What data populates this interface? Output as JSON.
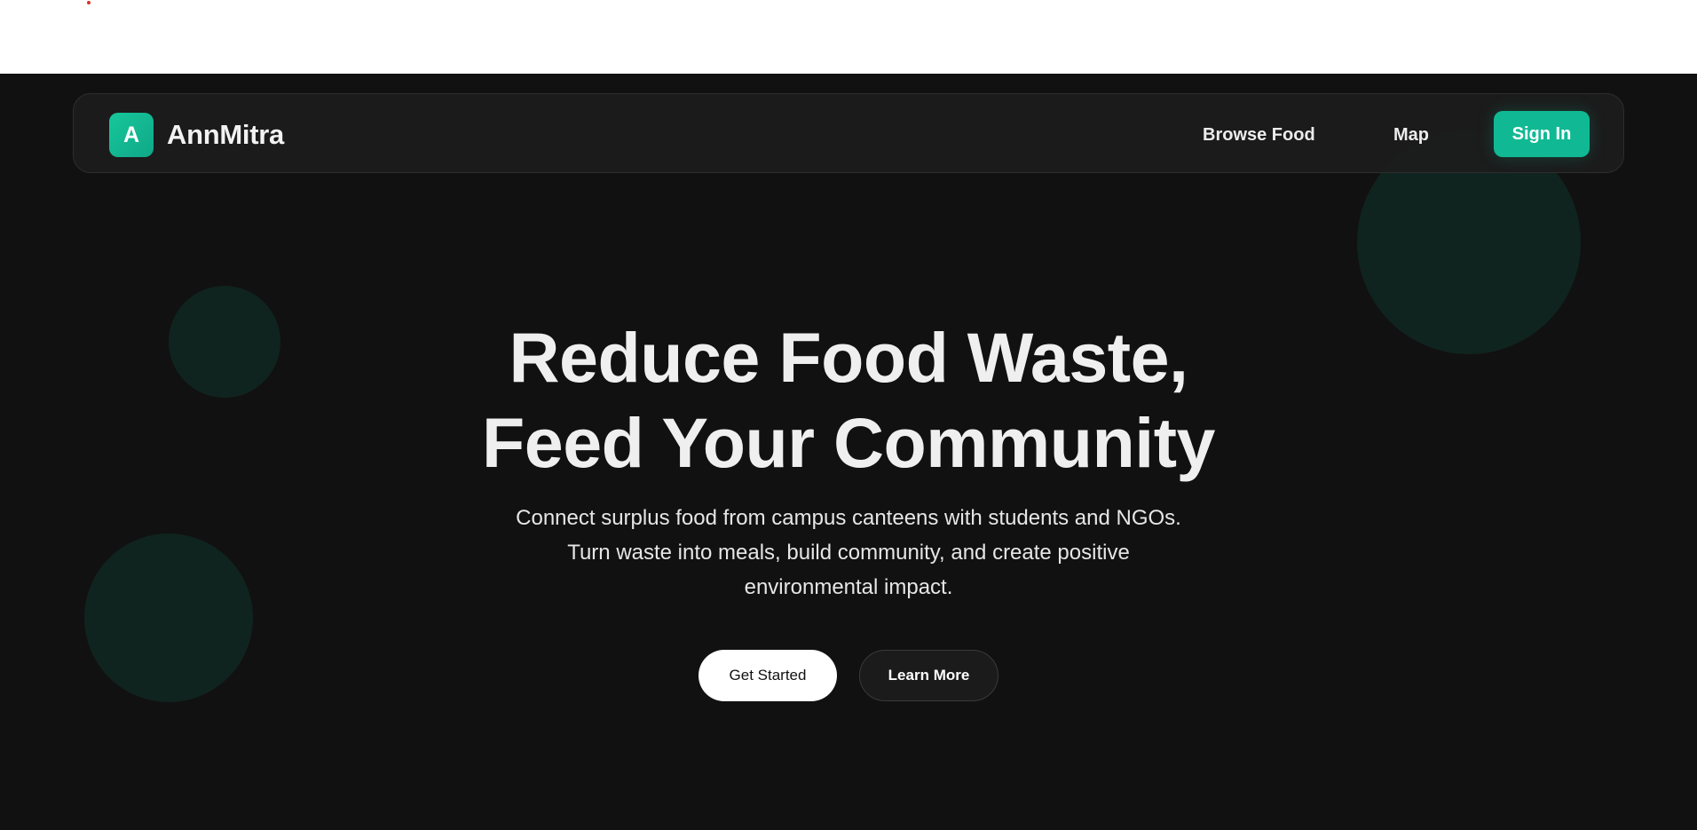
{
  "brand": {
    "logo_letter": "A",
    "name": "AnnMitra",
    "accent_color": "#10b994"
  },
  "nav": {
    "browse_label": "Browse Food",
    "map_label": "Map",
    "signin_label": "Sign In"
  },
  "hero": {
    "headline_line1": "Reduce Food Waste,",
    "headline_line2": "Feed Your Community",
    "subtext": "Connect surplus food from campus canteens with students and NGOs. Turn waste into meals, build community, and create positive environmental impact.",
    "primary_cta": "Get Started",
    "secondary_cta": "Learn More"
  }
}
